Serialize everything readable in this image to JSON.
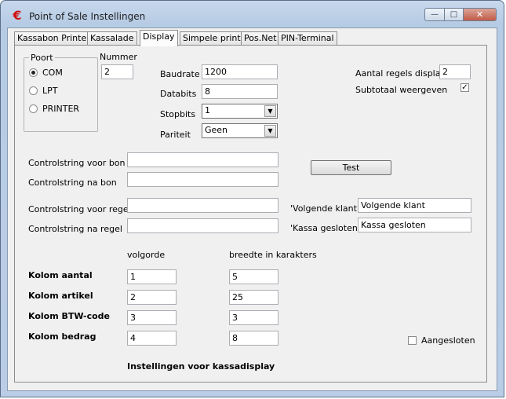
{
  "window": {
    "title": "Point of Sale Instellingen",
    "app_icon": "€",
    "controls": {
      "minimize": "—",
      "maximize": "□",
      "close": "✕"
    }
  },
  "tabs": [
    "Kassabon Printer",
    "Kassalade",
    "Display",
    "Simpele printer",
    "Pos.Net",
    "PIN-Terminal"
  ],
  "active_tab": "Display",
  "poort": {
    "legend": "Poort",
    "options": [
      "COM",
      "LPT",
      "PRINTER"
    ],
    "selected": "COM"
  },
  "nummer": {
    "label": "Nummer",
    "value": "2"
  },
  "serial": {
    "baudrate": {
      "label": "Baudrate",
      "value": "1200"
    },
    "databits": {
      "label": "Databits",
      "value": "8"
    },
    "stopbits": {
      "label": "Stopbits",
      "value": "1"
    },
    "pariteit": {
      "label": "Pariteit",
      "value": "Geen"
    }
  },
  "display": {
    "regels_label": "Aantal regels display",
    "regels_value": "2",
    "subtotaal_label": "Subtotaal weergeven",
    "subtotaal_checked": true
  },
  "controlstrings": {
    "voor_bon": {
      "label": "Controlstring voor bon",
      "value": ""
    },
    "na_bon": {
      "label": "Controlstring na bon",
      "value": ""
    },
    "voor_regel": {
      "label": "Controlstring voor regel",
      "value": ""
    },
    "na_regel": {
      "label": "Controlstring na regel",
      "value": ""
    }
  },
  "test_button": "Test",
  "volgende_klant": {
    "label": "'Volgende klant'",
    "value": "Volgende klant"
  },
  "kassa_gesloten": {
    "label": "'Kassa gesloten'",
    "value": "Kassa gesloten"
  },
  "kolommen": {
    "header_volgorde": "volgorde",
    "header_breedte": "breedte in karakters",
    "rows": [
      {
        "label": "Kolom aantal",
        "volgorde": "1",
        "breedte": "5"
      },
      {
        "label": "Kolom artikel",
        "volgorde": "2",
        "breedte": "25"
      },
      {
        "label": "Kolom BTW-code",
        "volgorde": "3",
        "breedte": "3"
      },
      {
        "label": "Kolom bedrag",
        "volgorde": "4",
        "breedte": "8"
      }
    ]
  },
  "aangesloten": {
    "label": "Aangesloten",
    "checked": false
  },
  "footer_title": "Instellingen voor kassadisplay"
}
